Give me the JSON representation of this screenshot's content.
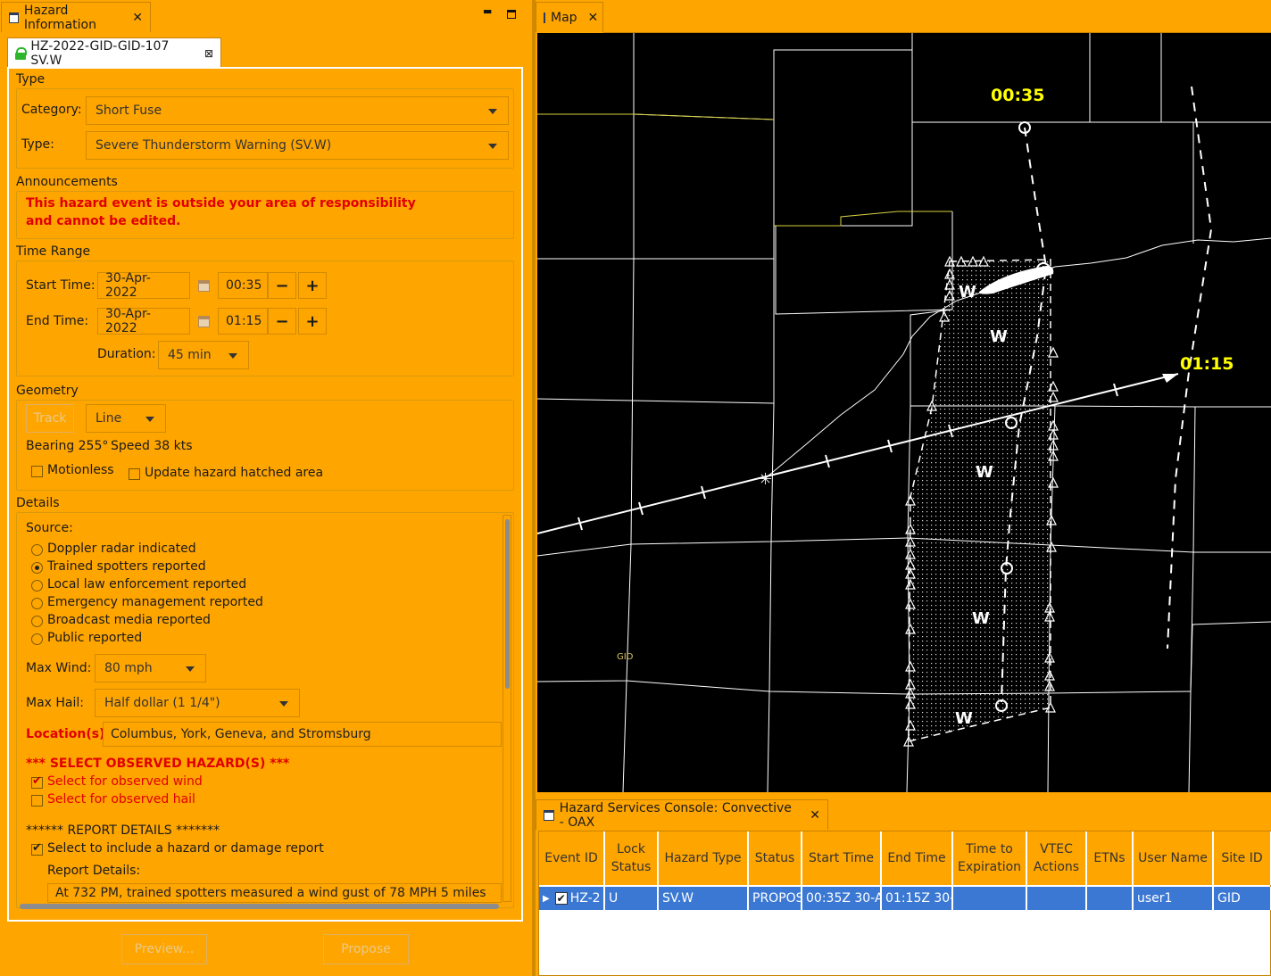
{
  "left_panel": {
    "view_title": "Hazard Information",
    "event_tab": "HZ-2022-GID-GID-107 SV.W",
    "type_group": {
      "label": "Type",
      "category_label": "Category:",
      "category_value": "Short Fuse",
      "type_label": "Type:",
      "type_value": "Severe Thunderstorm Warning (SV.W)"
    },
    "announcements": {
      "label": "Announcements",
      "line1": "This hazard event is outside your area of responsibility",
      "line2": "and cannot be edited."
    },
    "time_range": {
      "label": "Time Range",
      "start_label": "Start Time:",
      "start_date": "30-Apr-2022",
      "start_time": "00:35",
      "end_label": "End Time:",
      "end_date": "30-Apr-2022",
      "end_time": "01:15",
      "duration_label": "Duration:",
      "duration_value": "45 min",
      "minus": "−",
      "plus": "+"
    },
    "geometry": {
      "label": "Geometry",
      "track_button": "Track",
      "shape_value": "Line",
      "bearing": "Bearing 255°",
      "speed": "Speed 38 kts",
      "motionless_label": "Motionless",
      "update_hatched_label": "Update hazard hatched area"
    },
    "details": {
      "label": "Details",
      "source_label": "Source:",
      "sources": [
        {
          "label": "Doppler radar indicated",
          "selected": false
        },
        {
          "label": "Trained spotters reported",
          "selected": true
        },
        {
          "label": "Local law enforcement reported",
          "selected": false
        },
        {
          "label": "Emergency management reported",
          "selected": false
        },
        {
          "label": "Broadcast media reported",
          "selected": false
        },
        {
          "label": "Public reported",
          "selected": false
        }
      ],
      "max_wind_label": "Max Wind:",
      "max_wind_value": "80 mph",
      "max_hail_label": "Max Hail:",
      "max_hail_value": "Half dollar (1 1/4\")",
      "locations_label": "Location(s):",
      "locations_value": "Columbus, York, Geneva, and Stromsburg",
      "observed_header": "*** SELECT OBSERVED HAZARD(S) ***",
      "observed_wind": "Select for observed wind",
      "observed_hail": "Select for observed hail",
      "report_header": "****** REPORT DETAILS *******",
      "include_report": "Select to include a hazard or damage report",
      "report_details_label": "Report Details:",
      "report_details_text": "At 732 PM, trained spotters measured a wind gust of 78 MPH 5 miles"
    },
    "preview_button": "Preview...",
    "propose_button": "Propose"
  },
  "map": {
    "tab_title": "Map",
    "time_start_label": "00:35",
    "time_end_label": "01:15",
    "site_label": "GID",
    "warning_marks": [
      "W",
      "W",
      "W",
      "W",
      "W"
    ]
  },
  "console": {
    "tab_title": "Hazard Services Console: Convective - OAX",
    "columns": {
      "event_id": "Event ID",
      "lock_status_1": "Lock",
      "lock_status_2": "Status",
      "hazard_type": "Hazard Type",
      "status": "Status",
      "start_time": "Start Time",
      "end_time": "End Time",
      "time_to_exp_1": "Time to",
      "time_to_exp_2": "Expiration",
      "vtec_1": "VTEC",
      "vtec_2": "Actions",
      "etns": "ETNs",
      "user_name": "User Name",
      "site_id": "Site ID"
    },
    "row": {
      "event_id": "HZ-2",
      "lock_status": "U",
      "hazard_type": "SV.W",
      "status": "PROPOS",
      "start_time": "00:35Z 30-Ap",
      "end_time": "01:15Z 30-A",
      "time_to_expiration": "",
      "vtec_actions": "",
      "etns": "",
      "user_name": "user1",
      "site_id": "GID"
    }
  },
  "colors": {
    "background": "#ffa500",
    "map_background": "#000000",
    "time_label": "#ffff00",
    "selected_row": "#3a78d3",
    "alert_text": "#e00000"
  }
}
